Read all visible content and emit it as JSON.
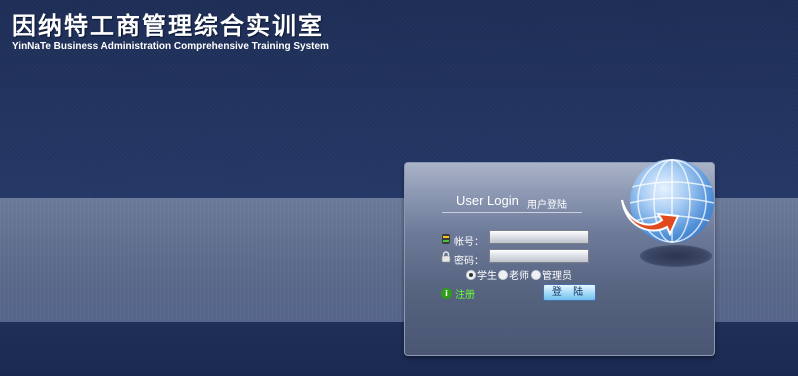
{
  "header": {
    "title_cn": "因纳特工商管理综合实训室",
    "title_en": "YinNaTe Business Administration Comprehensive Training System"
  },
  "login": {
    "title_en": "User Login",
    "title_cn": "用户登陆",
    "account_label": "帐号：",
    "password_label": "密码：",
    "account_value": "",
    "password_value": "",
    "roles": [
      {
        "label": "学生",
        "checked": true
      },
      {
        "label": "老师",
        "checked": false
      },
      {
        "label": "管理员",
        "checked": false
      }
    ],
    "register_label": "注册",
    "submit_label": "登 陆"
  },
  "icons": {
    "account": "user-icon",
    "password": "lock-icon",
    "register": "info-icon",
    "globe": "globe-icon",
    "arrow": "arrow-icon"
  },
  "colors": {
    "register_link": "#66ff33",
    "background_dark": "#1b2a4f"
  }
}
